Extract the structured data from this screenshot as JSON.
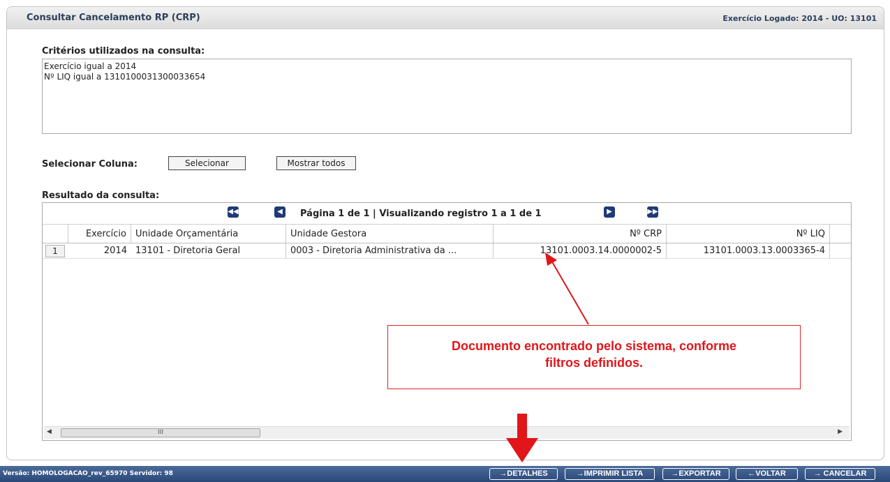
{
  "header": {
    "title": "Consultar Cancelamento RP (CRP)",
    "context": "Exercício Logado: 2014 - UO: 13101"
  },
  "criteria": {
    "label": "Critérios utilizados na consulta:",
    "lines": [
      "Exercício igual a 2014",
      "Nº LIQ igual a 1310100031300033654"
    ]
  },
  "column_select": {
    "label": "Selecionar Coluna:",
    "select_label": "Selecionar",
    "show_all_label": "Mostrar todos"
  },
  "results": {
    "label": "Resultado da consulta:",
    "pager_text": "Página 1 de 1 | Visualizando registro 1 a 1 de 1",
    "columns": [
      "Exercício",
      "Unidade Orçamentária",
      "Unidade Gestora",
      "Nº CRP",
      "Nº LIQ"
    ],
    "rows": [
      {
        "num": "1",
        "exercicio": "2014",
        "unidade_orcamentaria": "13101 - Diretoria Geral",
        "unidade_gestora": "0003 - Diretoria Administrativa da ...",
        "crp": "13101.0003.14.0000002-5",
        "liq": "13101.0003.13.0003365-4"
      }
    ],
    "scroll_thumb_text": "III"
  },
  "annotation": {
    "text_line1": "Documento encontrado pelo sistema, conforme",
    "text_line2": "filtros definidos.",
    "color": "#e0161a"
  },
  "footer": {
    "info": "Versão: HOMOLOGACAO_rev_65970 Servidor: 98",
    "buttons": [
      "→DETALHES",
      "→IMPRIMIR LISTA",
      "→EXPORTAR",
      "←VOLTAR",
      "→ CANCELAR"
    ]
  },
  "colors": {
    "title": "#2c3f5b",
    "footer_bar": "#2a4878",
    "pager_button": "#1e3a78",
    "annotation_red": "#e0161a"
  },
  "icons": {
    "pager_first": "double-left-arrow-icon",
    "pager_prev": "left-arrow-icon",
    "pager_next": "right-arrow-icon",
    "pager_last": "double-right-arrow-icon"
  }
}
